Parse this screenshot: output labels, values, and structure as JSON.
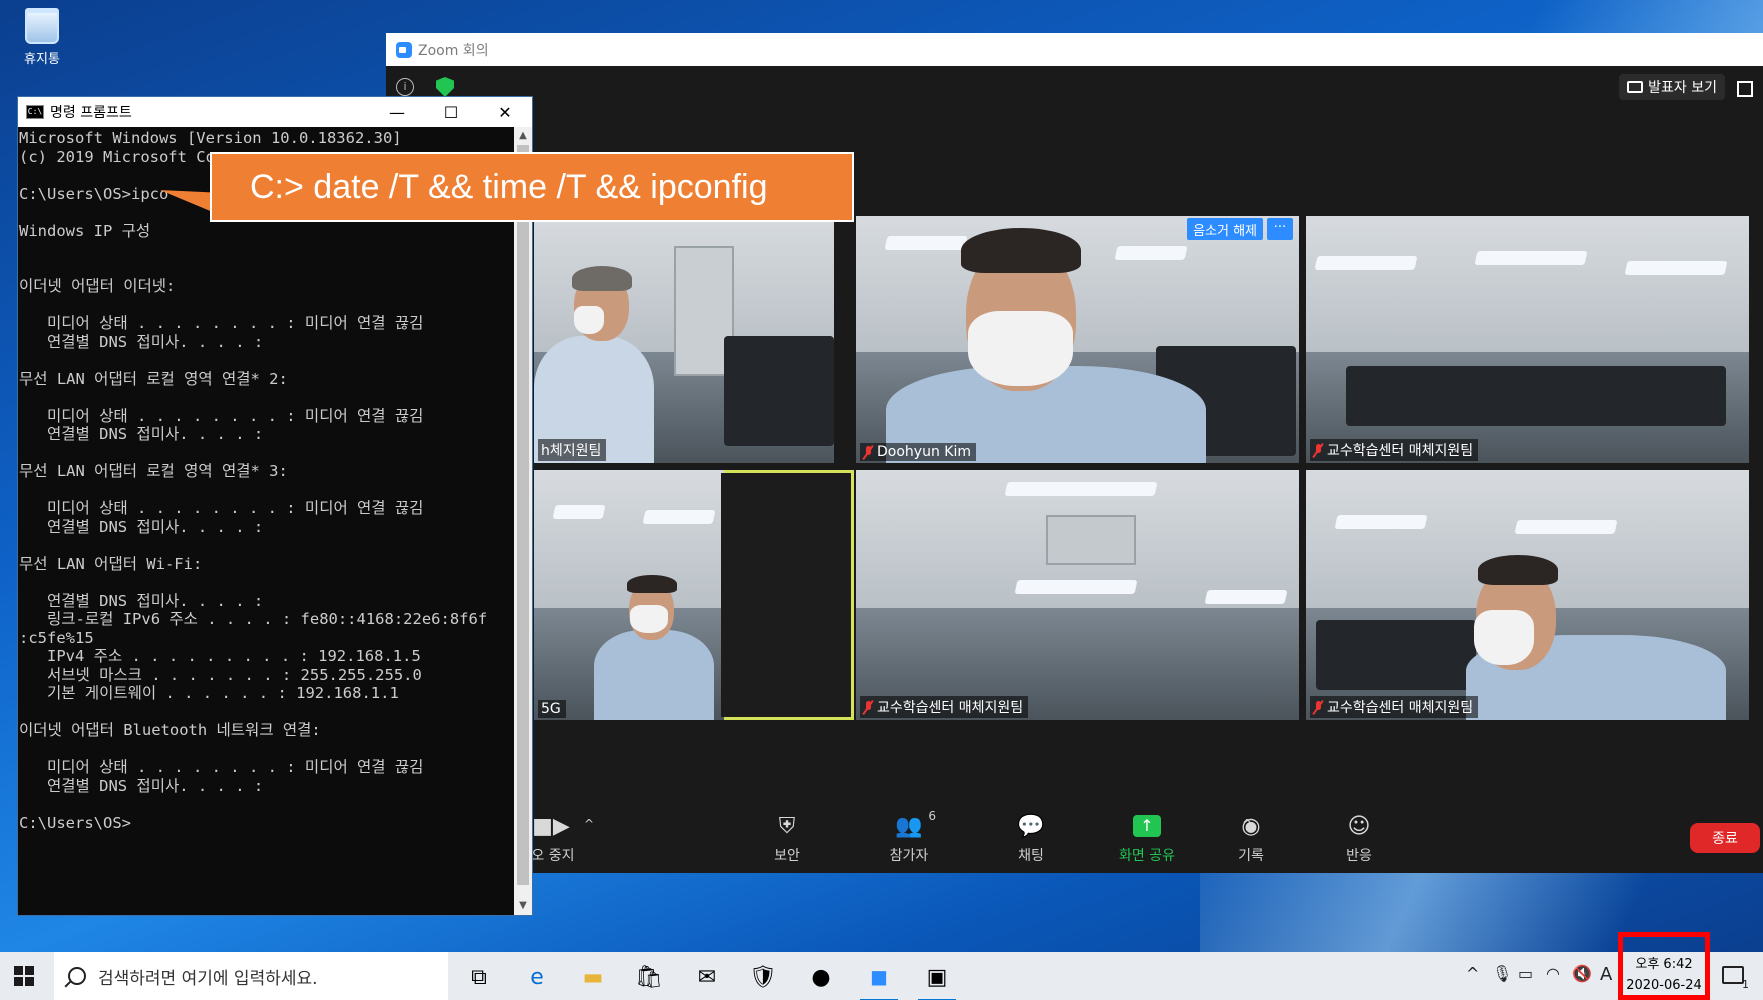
{
  "desktop": {
    "recycle_bin_label": "휴지통"
  },
  "zoom": {
    "window_title": "Zoom 회의",
    "speaker_view_label": "발표자 보기",
    "unmute_label": "음소거 해제",
    "more_label": "···",
    "tiles": [
      {
        "label": "h체지원팀"
      },
      {
        "label": "Doohyun Kim"
      },
      {
        "label": "교수학습센터 매체지원팀"
      },
      {
        "label": "5G"
      },
      {
        "label": "교수학습센터 매체지원팀"
      },
      {
        "label": "교수학습센터 매체지원팀"
      }
    ],
    "toolbar": {
      "video_label": "l오 중지",
      "security_label": "보안",
      "participants_label": "참가자",
      "participants_count": "6",
      "chat_label": "채팅",
      "share_label": "화면 공유",
      "record_label": "기록",
      "reactions_label": "반응",
      "end_label": "종료"
    }
  },
  "cmd": {
    "window_title": "명령 프롬프트",
    "icon_text": "C:\\",
    "lines": [
      "Microsoft Windows [Version 10.0.18362.30]",
      "(c) 2019 Microsoft Co",
      "",
      "C:\\Users\\OS>ipco",
      "",
      "Windows IP 구성",
      "",
      "",
      "이더넷 어댑터 이더넷:",
      "",
      "   미디어 상태 . . . . . . . . : 미디어 연결 끊김",
      "   연결별 DNS 접미사. . . . :",
      "",
      "무선 LAN 어댑터 로컬 영역 연결* 2:",
      "",
      "   미디어 상태 . . . . . . . . : 미디어 연결 끊김",
      "   연결별 DNS 접미사. . . . :",
      "",
      "무선 LAN 어댑터 로컬 영역 연결* 3:",
      "",
      "   미디어 상태 . . . . . . . . : 미디어 연결 끊김",
      "   연결별 DNS 접미사. . . . :",
      "",
      "무선 LAN 어댑터 Wi-Fi:",
      "",
      "   연결별 DNS 접미사. . . . :",
      "   링크-로컬 IPv6 주소 . . . . : fe80::4168:22e6:8f6f",
      ":c5fe%15",
      "   IPv4 주소 . . . . . . . . . : 192.168.1.5",
      "   서브넷 마스크 . . . . . . . : 255.255.255.0",
      "   기본 게이트웨이 . . . . . . : 192.168.1.1",
      "",
      "이더넷 어댑터 Bluetooth 네트워크 연결:",
      "",
      "   미디어 상태 . . . . . . . . : 미디어 연결 끊김",
      "   연결별 DNS 접미사. . . . :",
      "",
      "C:\\Users\\OS>"
    ]
  },
  "callout": {
    "text": "C:> date /T && time /T && ipconfig",
    "color": "#ee7f33"
  },
  "taskbar": {
    "search_placeholder": "검색하려면 여기에 입력하세요.",
    "clock_time": "오후 6:42",
    "clock_date": "2020-06-24",
    "tray_ime": "A",
    "notification_count": "1"
  },
  "colors": {
    "zoom_blue": "#2d8cff",
    "zoom_green": "#23c552",
    "end_red": "#e02828",
    "highlight_red": "#ff0000"
  }
}
